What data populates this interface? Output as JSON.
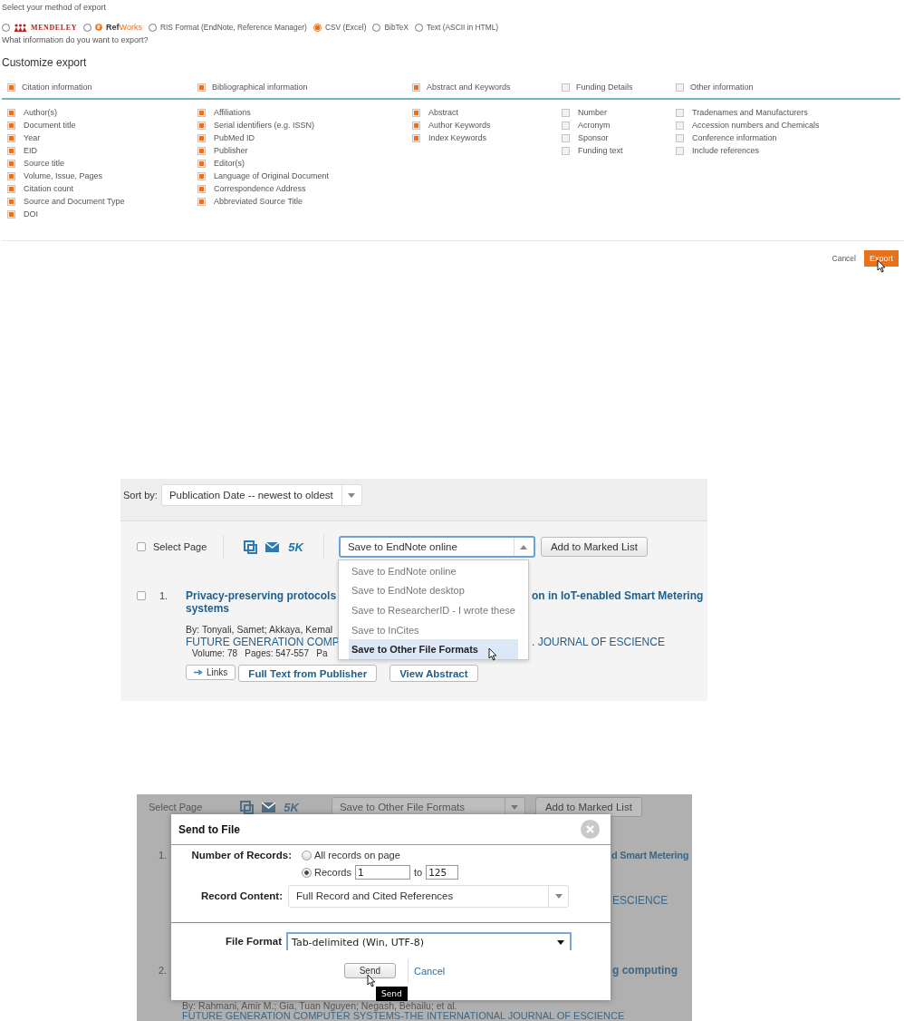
{
  "export_panel": {
    "method_prompt": "Select your method of export",
    "methods": [
      {
        "kind": "mendeley",
        "label": "MENDELEY",
        "selected": false
      },
      {
        "kind": "refworks",
        "label": "**Ref**Works",
        "selected": false
      },
      {
        "kind": "text",
        "label": "RIS Format (EndNote, Reference Manager)",
        "selected": false
      },
      {
        "kind": "text",
        "label": "CSV (Excel)",
        "selected": true
      },
      {
        "kind": "text",
        "label": "BibTeX",
        "selected": false
      },
      {
        "kind": "text",
        "label": "Text (ASCII in HTML)",
        "selected": false
      }
    ],
    "info_prompt": "What information do you want to export?",
    "customize_title": "Customize export",
    "groups": [
      {
        "label": "Citation information",
        "checked": true,
        "items": [
          {
            "label": "Author(s)",
            "checked": true
          },
          {
            "label": "Document title",
            "checked": true
          },
          {
            "label": "Year",
            "checked": true
          },
          {
            "label": "EID",
            "checked": true
          },
          {
            "label": "Source title",
            "checked": true
          },
          {
            "label": "Volume, Issue, Pages",
            "checked": true
          },
          {
            "label": "Citation count",
            "checked": true
          },
          {
            "label": "Source and Document Type",
            "checked": true
          },
          {
            "label": "DOI",
            "checked": true
          }
        ]
      },
      {
        "label": "Bibliographical information",
        "checked": true,
        "items": [
          {
            "label": "Affiliations",
            "checked": true
          },
          {
            "label": "Serial identifiers (e.g. ISSN)",
            "checked": true
          },
          {
            "label": "PubMed ID",
            "checked": true
          },
          {
            "label": "Publisher",
            "checked": true
          },
          {
            "label": "Editor(s)",
            "checked": true
          },
          {
            "label": "Language of Original Document",
            "checked": true
          },
          {
            "label": "Correspondence Address",
            "checked": true
          },
          {
            "label": "Abbreviated Source Title",
            "checked": true
          }
        ]
      },
      {
        "label": "Abstract and Keywords",
        "checked": true,
        "items": [
          {
            "label": "Abstract",
            "checked": true
          },
          {
            "label": "Author Keywords",
            "checked": true
          },
          {
            "label": "Index Keywords",
            "checked": true
          }
        ]
      },
      {
        "label": "Funding Details",
        "checked": false,
        "items": [
          {
            "label": "Number",
            "checked": false
          },
          {
            "label": "Acronym",
            "checked": false
          },
          {
            "label": "Sponsor",
            "checked": false
          },
          {
            "label": "Funding text",
            "checked": false
          }
        ]
      },
      {
        "label": "Other information",
        "checked": false,
        "items": [
          {
            "label": "Tradenames and Manufacturers",
            "checked": false
          },
          {
            "label": "Accession numbers and Chemicals",
            "checked": false
          },
          {
            "label": "Conference information",
            "checked": false
          },
          {
            "label": "Include references",
            "checked": false
          }
        ]
      }
    ],
    "cancel": "Cancel",
    "export": "Export"
  },
  "results_view": {
    "sort_label": "Sort by:",
    "sort_value": "Publication Date -- newest to oldest",
    "select_page": {
      "label": "Select Page",
      "checked": false
    },
    "export_count": "5K",
    "save_select": {
      "value": "Save to EndNote online",
      "expanded": true,
      "options": [
        {
          "label": "Save to EndNote online",
          "highlighted": false
        },
        {
          "label": "Save to EndNote desktop",
          "highlighted": false
        },
        {
          "label": "Save to ResearcherID - I wrote these",
          "highlighted": false
        },
        {
          "label": "Save to InCites",
          "highlighted": false
        },
        {
          "label": "Save to Other File Formats",
          "highlighted": true
        }
      ]
    },
    "add_button": "Add to Marked List",
    "result": {
      "number": "1.",
      "checked": false,
      "title_start": "Privacy-preserving protocols",
      "title_end": "on in IoT-enabled Smart Metering",
      "title_line2": "systems",
      "authors": "By: Tonyali, Samet; Akkaya, Kemal",
      "journal_start": "FUTURE GENERATION COMP",
      "journal_end": ". JOURNAL OF ESCIENCE",
      "details": "Volume: 78   Pages: 547-557   Pa",
      "buttons": [
        {
          "kind": "links",
          "label": "Links"
        },
        {
          "kind": "publisher",
          "label": "Full Text from Publisher"
        },
        {
          "kind": "abstract",
          "label": "View Abstract"
        }
      ]
    }
  },
  "send_view": {
    "background": {
      "select_page": "Select Page",
      "export_count": "5K",
      "save_select": "Save to Other File Formats",
      "add_button": "Add to Marked List",
      "row_1": {
        "number": "1.",
        "title_fragment": "d Smart Metering",
        "journal_fragment": "ESCIENCE"
      },
      "row_2": {
        "number": "2.",
        "title_fragment": "g computing",
        "authors": "By: Rahmani, Amir M.; Gia, Tuan Nguyen; Negash, Behailu; et al.",
        "journal": "FUTURE GENERATION COMPUTER SYSTEMS-THE INTERNATIONAL JOURNAL OF ESCIENCE"
      }
    },
    "dialog": {
      "title": "Send to File",
      "records_label": "Number of Records:",
      "record_options": [
        {
          "kind": "all",
          "label": "All records on page",
          "selected": false
        },
        {
          "kind": "range",
          "label": "Records",
          "selected": true,
          "from": "1",
          "to_label": "to",
          "to": "125"
        }
      ],
      "content_label": "Record Content:",
      "content_value": "Full Record and Cited References",
      "format_label": "File Format",
      "format_value": "Tab-delimited (Win, UTF-8)",
      "send": "Send",
      "cancel": "Cancel",
      "tooltip": "Send"
    }
  }
}
